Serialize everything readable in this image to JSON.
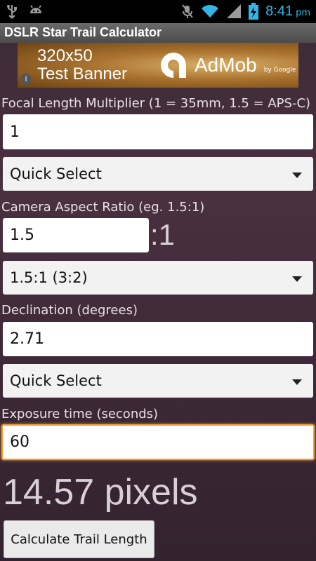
{
  "status_bar": {
    "time": "8:41",
    "ampm": "pm",
    "icons": [
      "usb-icon",
      "android-icon",
      "mute-icon",
      "wifi-icon",
      "signal-icon",
      "battery-charging-icon"
    ],
    "time_color": "#33b5e5"
  },
  "app": {
    "title": "DSLR Star Trail Calculator"
  },
  "ad": {
    "text_line1": "320x50",
    "text_line2": "Test Banner",
    "brand": "AdMob",
    "byline": "by Google",
    "info_glyph": "i"
  },
  "focal": {
    "label": "Focal Length Multiplier (1 = 35mm, 1.5 = APS-C)",
    "value": "1",
    "quick_select": "Quick Select"
  },
  "aspect": {
    "label": "Camera Aspect Ratio (eg. 1.5:1)",
    "value": "1.5",
    "suffix": ":1",
    "selected": "1.5:1 (3:2)"
  },
  "declination": {
    "label": "Declination (degrees)",
    "value": "2.71",
    "quick_select": "Quick Select"
  },
  "exposure": {
    "label": "Exposure time (seconds)",
    "value": "60",
    "focus_color": "#f0a030"
  },
  "result": {
    "text": "14.57 pixels"
  },
  "calculate_button": {
    "label": "Calculate Trail Length"
  }
}
